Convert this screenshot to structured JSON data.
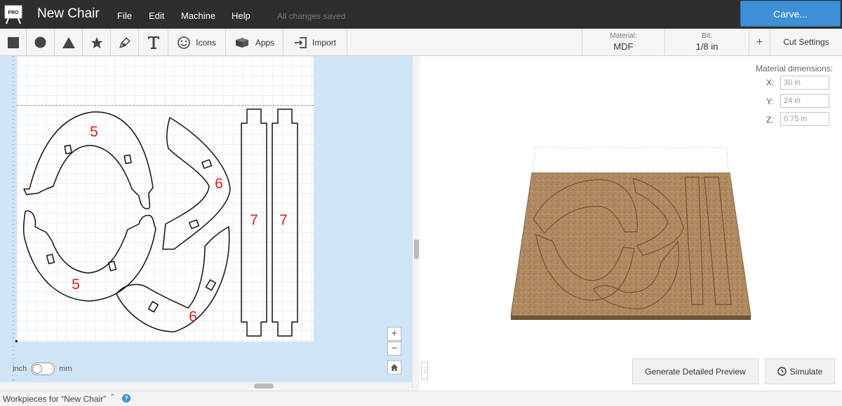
{
  "app": {
    "title": "New Chair",
    "status": "All changes saved",
    "carve_label": "Carve..."
  },
  "menu": [
    "File",
    "Edit",
    "Machine",
    "Help"
  ],
  "toolbar": {
    "icons_label": "Icons",
    "apps_label": "Apps",
    "import_label": "Import",
    "material_caption": "Material:",
    "material_value": "MDF",
    "bit_caption": "Bit:",
    "bit_value": "1/8 in",
    "add_symbol": "+",
    "cut_settings_label": "Cut Settings"
  },
  "design": {
    "part_labels": [
      "5",
      "6",
      "7",
      "7",
      "5",
      "6"
    ],
    "part_label_color": "#d42020"
  },
  "units": {
    "left": "inch",
    "right": "mm"
  },
  "zoom": {
    "in": "+",
    "out": "−"
  },
  "preview": {
    "material_dimensions_title": "Material dimensions:",
    "x_label": "X:",
    "x_value": "30 in",
    "y_label": "Y:",
    "y_value": "24 in",
    "z_label": "Z:",
    "z_value": "0.75 in",
    "generate_label": "Generate Detailed Preview",
    "simulate_label": "Simulate"
  },
  "footer": {
    "workpieces_label": "Workpieces for “New Chair”"
  },
  "colors": {
    "accent": "#3d8fd6",
    "topbar": "#2e2e2e",
    "canvas_bg": "#cfe4f7",
    "mdf": "#b08a61"
  }
}
